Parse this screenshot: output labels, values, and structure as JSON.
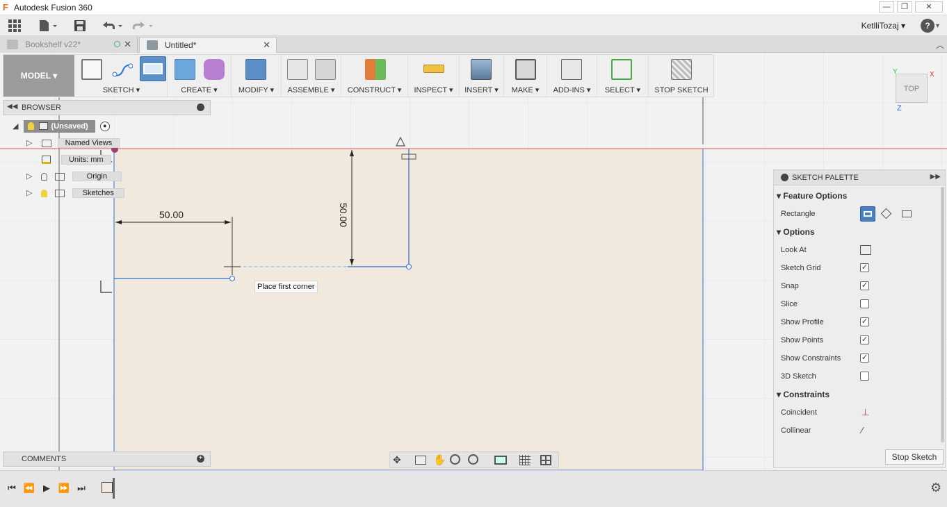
{
  "window": {
    "title": "Autodesk Fusion 360",
    "logo_letter": "F",
    "min_glyph": "—",
    "max_glyph": "❐",
    "close_glyph": "✕"
  },
  "quick_access": {
    "user": "KetlliTozaj",
    "user_caret": "▾",
    "help_glyph": "?"
  },
  "tabs": [
    {
      "label": "Bookshelf v22*",
      "active": false
    },
    {
      "label": "Untitled*",
      "active": true
    }
  ],
  "toolbar": {
    "workspace": "MODEL",
    "groups": [
      {
        "label": "SKETCH",
        "icons": [
          "create-sketch-icon",
          "arc-icon",
          "rectangle-icon"
        ]
      },
      {
        "label": "CREATE",
        "icons": [
          "extrude-box-icon",
          "form-icon"
        ]
      },
      {
        "label": "MODIFY",
        "icons": [
          "press-pull-icon"
        ]
      },
      {
        "label": "ASSEMBLE",
        "icons": [
          "new-component-icon",
          "joint-icon"
        ]
      },
      {
        "label": "CONSTRUCT",
        "icons": [
          "plane-icon"
        ]
      },
      {
        "label": "INSPECT",
        "icons": [
          "measure-icon"
        ]
      },
      {
        "label": "INSERT",
        "icons": [
          "insert-image-icon"
        ]
      },
      {
        "label": "MAKE",
        "icons": [
          "print-icon"
        ]
      },
      {
        "label": "ADD-INS",
        "icons": [
          "scripts-icon"
        ]
      },
      {
        "label": "SELECT",
        "icons": [
          "select-icon"
        ]
      },
      {
        "label": "STOP SKETCH",
        "icons": [
          "stop-sketch-icon"
        ]
      }
    ]
  },
  "browser": {
    "title": "BROWSER",
    "root": "(Unsaved)",
    "items": [
      {
        "label": "Named Views"
      },
      {
        "label": "Units: mm"
      },
      {
        "label": "Origin"
      },
      {
        "label": "Sketches"
      }
    ]
  },
  "comments": {
    "title": "COMMENTS"
  },
  "sketch": {
    "dim_horizontal": "50.00",
    "dim_vertical": "50.00",
    "tooltip": "Place first corner"
  },
  "viewcube": {
    "face": "TOP",
    "axis_x": "X",
    "axis_y": "Y",
    "axis_z": "Z"
  },
  "palette": {
    "title": "SKETCH PALETTE",
    "feature_options_title": "Feature Options",
    "rectangle_label": "Rectangle",
    "options_title": "Options",
    "options": [
      {
        "label": "Look At",
        "type": "button"
      },
      {
        "label": "Sketch Grid",
        "checked": true
      },
      {
        "label": "Snap",
        "checked": true
      },
      {
        "label": "Slice",
        "checked": false
      },
      {
        "label": "Show Profile",
        "checked": true
      },
      {
        "label": "Show Points",
        "checked": true
      },
      {
        "label": "Show Constraints",
        "checked": true
      },
      {
        "label": "3D Sketch",
        "checked": false
      }
    ],
    "constraints_title": "Constraints",
    "constraints": [
      {
        "label": "Coincident"
      },
      {
        "label": "Collinear"
      }
    ],
    "stop_button": "Stop Sketch"
  },
  "colors": {
    "sketch_plane": "#f2e9de",
    "sketch_line": "#2a6fd6",
    "axis_red": "#d33",
    "accent_blue": "#3c7dc2"
  }
}
